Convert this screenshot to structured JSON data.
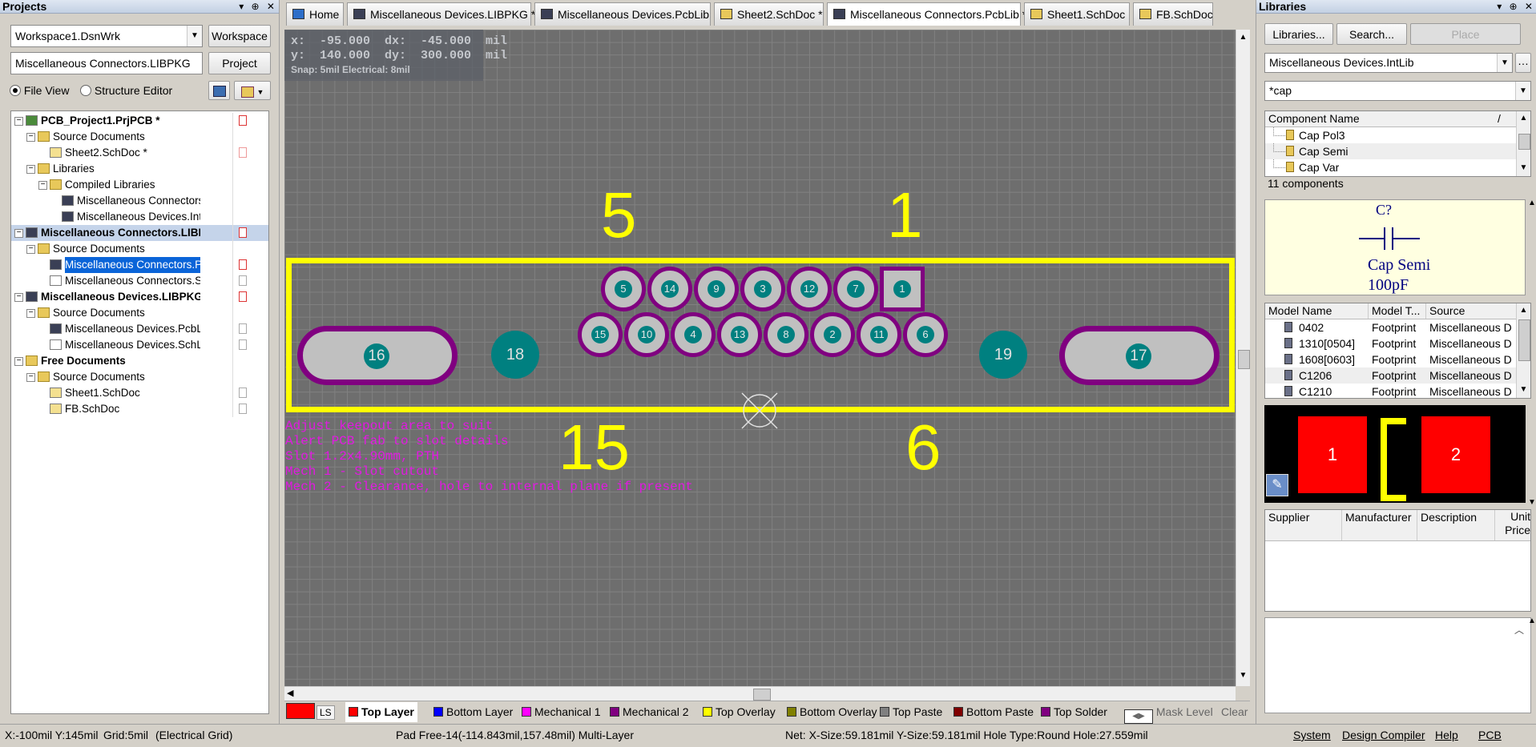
{
  "projects_panel": {
    "title": "Projects",
    "workspace_value": "Workspace1.DsnWrk",
    "workspace_button": "Workspace",
    "project_value": "Miscellaneous Connectors.LIBPKG",
    "project_button": "Project",
    "file_view": "File View",
    "structure_editor": "Structure Editor",
    "tree": [
      {
        "label": "PCB_Project1.PrjPCB *",
        "bold": true
      },
      {
        "label": "Source Documents"
      },
      {
        "label": "Sheet2.SchDoc *"
      },
      {
        "label": "Libraries"
      },
      {
        "label": "Compiled Libraries"
      },
      {
        "label": "Miscellaneous Connectors.IntL"
      },
      {
        "label": "Miscellaneous Devices.IntLib"
      },
      {
        "label": "Miscellaneous Connectors.LIBPI",
        "bold": true
      },
      {
        "label": "Source Documents"
      },
      {
        "label": "Miscellaneous Connectors.PcbLit",
        "selected": true
      },
      {
        "label": "Miscellaneous Connectors.SchLit"
      },
      {
        "label": "Miscellaneous Devices.LIBPKG",
        "bold": true
      },
      {
        "label": "Source Documents"
      },
      {
        "label": "Miscellaneous Devices.PcbLib"
      },
      {
        "label": "Miscellaneous Devices.SchLib"
      },
      {
        "label": "Free Documents",
        "bold": true
      },
      {
        "label": "Source Documents"
      },
      {
        "label": "Sheet1.SchDoc"
      },
      {
        "label": "FB.SchDoc"
      }
    ]
  },
  "tabs": [
    "Home",
    "Miscellaneous Devices.LIBPKG *",
    "Miscellaneous Devices.PcbLib",
    "Sheet2.SchDoc *",
    "Miscellaneous Connectors.PcbLib *",
    "Sheet1.SchDoc",
    "FB.SchDoc"
  ],
  "canvas": {
    "coords_line1": "x:  -95.000  dx:  -45.000  mil",
    "coords_line2": "y:  140.000  dy:  300.000  mil",
    "snap": "Snap: 5mil Electrical: 8mil",
    "labels": {
      "p5": "5",
      "p1": "1",
      "p15": "15",
      "p6": "6"
    },
    "note_lines": [
      "Adjust keepout area to suit",
      "Alert PCB fab to slot details",
      "Slot 1.2x4.90mm, PTH",
      "Mech 1 - Slot cutout",
      "Mech 2 - Clearance, hole to internal plane if present"
    ],
    "pads_top": [
      "5",
      "14",
      "9",
      "3",
      "12",
      "7",
      "1"
    ],
    "pads_bottom": [
      "15",
      "10",
      "4",
      "13",
      "8",
      "2",
      "11",
      "6"
    ],
    "mount_holes": [
      "18",
      "19"
    ],
    "slots": [
      "16",
      "17"
    ],
    "colors": {
      "outline": "#ffff00",
      "pad_ring": "#800080",
      "pad_hole": "#008080",
      "pad_fill": "#c0c0c0",
      "text": "#e218e2"
    }
  },
  "layer_tabs": {
    "ls": "LS",
    "layers": [
      {
        "name": "Top Layer",
        "color": "#ff0000",
        "active": true
      },
      {
        "name": "Bottom Layer",
        "color": "#0000ff"
      },
      {
        "name": "Mechanical 1",
        "color": "#ff00ff"
      },
      {
        "name": "Mechanical 2",
        "color": "#800080"
      },
      {
        "name": "Top Overlay",
        "color": "#ffff00"
      },
      {
        "name": "Bottom Overlay",
        "color": "#808000"
      },
      {
        "name": "Top Paste",
        "color": "#808080"
      },
      {
        "name": "Bottom Paste",
        "color": "#800000"
      },
      {
        "name": "Top Solder",
        "color": "#800080"
      }
    ],
    "mask_level": "Mask Level",
    "clear": "Clear"
  },
  "status": {
    "xy": "X:-100mil Y:145mil",
    "grid": "Grid:5mil",
    "grid_type": "(Electrical Grid)",
    "pad": "Pad Free-14(-114.843mil,157.48mil)  Multi-Layer",
    "net": "Net: X-Size:59.181mil Y-Size:59.181mil Hole Type:Round Hole:27.559mil",
    "buttons": [
      "System",
      "Design Compiler",
      "Help",
      "PCB"
    ]
  },
  "libraries_panel": {
    "title": "Libraries",
    "buttons": [
      "Libraries...",
      "Search...",
      "Place"
    ],
    "library_value": "Miscellaneous Devices.IntLib",
    "filter_value": "*cap",
    "component_header": "Component Name",
    "components": [
      "Cap Pol3",
      "Cap Semi",
      "Cap Var"
    ],
    "component_count": "11 components",
    "symbol": {
      "designator": "C?",
      "name": "Cap Semi",
      "value": "100pF"
    },
    "model_headers": [
      "Model Name",
      "Model T...",
      "Source"
    ],
    "models": [
      {
        "name": "0402",
        "type": "Footprint",
        "source": "Miscellaneous D"
      },
      {
        "name": "1310[0504]",
        "type": "Footprint",
        "source": "Miscellaneous D"
      },
      {
        "name": "1608[0603]",
        "type": "Footprint",
        "source": "Miscellaneous D"
      },
      {
        "name": "C1206",
        "type": "Footprint",
        "source": "Miscellaneous D"
      },
      {
        "name": "C1210",
        "type": "Footprint",
        "source": "Miscellaneous D"
      }
    ],
    "footprint_pads": [
      "1",
      "2"
    ],
    "supplier_headers": [
      "Supplier",
      "Manufacturer",
      "Description",
      "Unit Price"
    ]
  }
}
